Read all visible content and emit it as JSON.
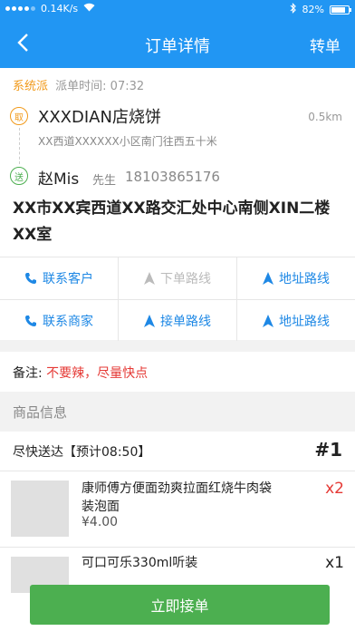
{
  "status_bar": {
    "network_speed": "0.14K/s",
    "battery": "82%",
    "battery_level": 0.82
  },
  "nav": {
    "title": "订单详情",
    "transfer_label": "转单"
  },
  "order": {
    "dispatch_type": "系统派",
    "dispatch_time": "派单时间: 07:32",
    "pickup_badge": "取",
    "deliver_badge": "送",
    "shop_name": "XXXDIAN店烧饼",
    "shop_distance": "0.5km",
    "shop_address": "XX西道XXXXXX小区南门往西五十米",
    "customer_name": "赵Mis",
    "customer_title": "先生",
    "customer_phone": "18103865176",
    "customer_address": "XX市XX宾西道XX路交汇处中心南侧XIN二楼XX室"
  },
  "actions": {
    "contact_customer": "联系客户",
    "order_route": "下单路线",
    "address_route_1": "地址路线",
    "contact_merchant": "联系商家",
    "pickup_route": "接单路线",
    "address_route_2": "地址路线"
  },
  "remark": {
    "label": "备注:",
    "value": "不要辣，尽量快点"
  },
  "goods": {
    "header": "商品信息",
    "delivery_label": "尽快送达【预计08:50】",
    "order_number": "#1",
    "items": [
      {
        "name": "康师傅方便面劲爽拉面红烧牛肉袋装泡面",
        "price": "¥4.00",
        "qty": "x2"
      },
      {
        "name": "可口可乐330ml听装",
        "qty": "x1"
      }
    ]
  },
  "accept_button": "立即接单",
  "colors": {
    "primary": "#2196f3",
    "accent_orange": "#f19a1b",
    "green": "#4caf50",
    "red": "#e53935"
  }
}
